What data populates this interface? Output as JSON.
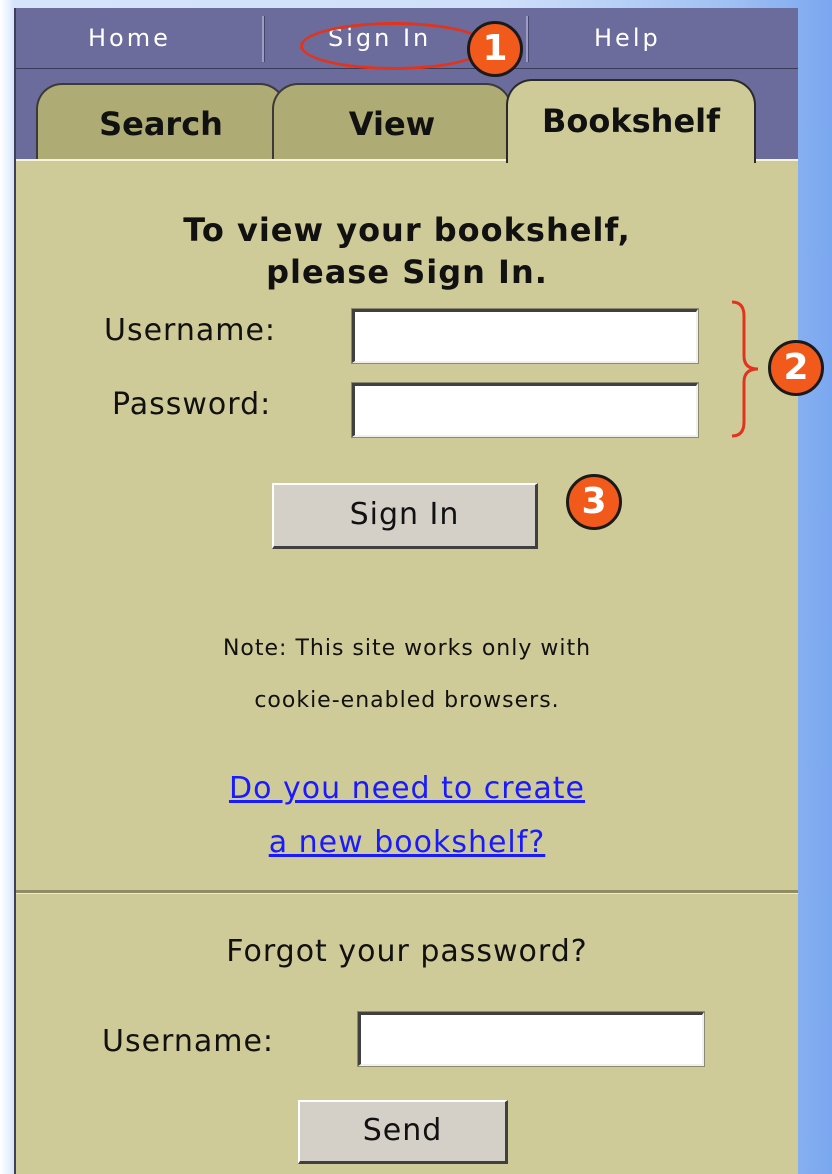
{
  "nav": {
    "home": "Home",
    "sign_in": "Sign In",
    "help": "Help"
  },
  "tabs": {
    "search": "Search",
    "view": "View",
    "bookshelf": "Bookshelf"
  },
  "signin": {
    "prompt_line1": "To view your bookshelf,",
    "prompt_line2": "please Sign In.",
    "username_label": "Username:",
    "password_label": "Password:",
    "username_value": "",
    "password_value": "",
    "submit_label": "Sign In"
  },
  "note": {
    "line1": "Note: This site works only with",
    "line2": "cookie-enabled browsers."
  },
  "create": {
    "line1": "Do you need to create",
    "line2": "a new bookshelf?"
  },
  "forgot": {
    "title": "Forgot your password?",
    "username_label": "Username:",
    "username_value": "",
    "send_label": "Send"
  },
  "annotations": {
    "step1": "1",
    "step2": "2",
    "step3": "3",
    "badge_color": "#f15a1a",
    "oval_color": "#e2341c"
  },
  "colors": {
    "nav_bg": "#6b6b9c",
    "panel_bg": "#cfcb98",
    "inactive_tab_bg": "#aeab74",
    "link": "#1a1aff"
  }
}
